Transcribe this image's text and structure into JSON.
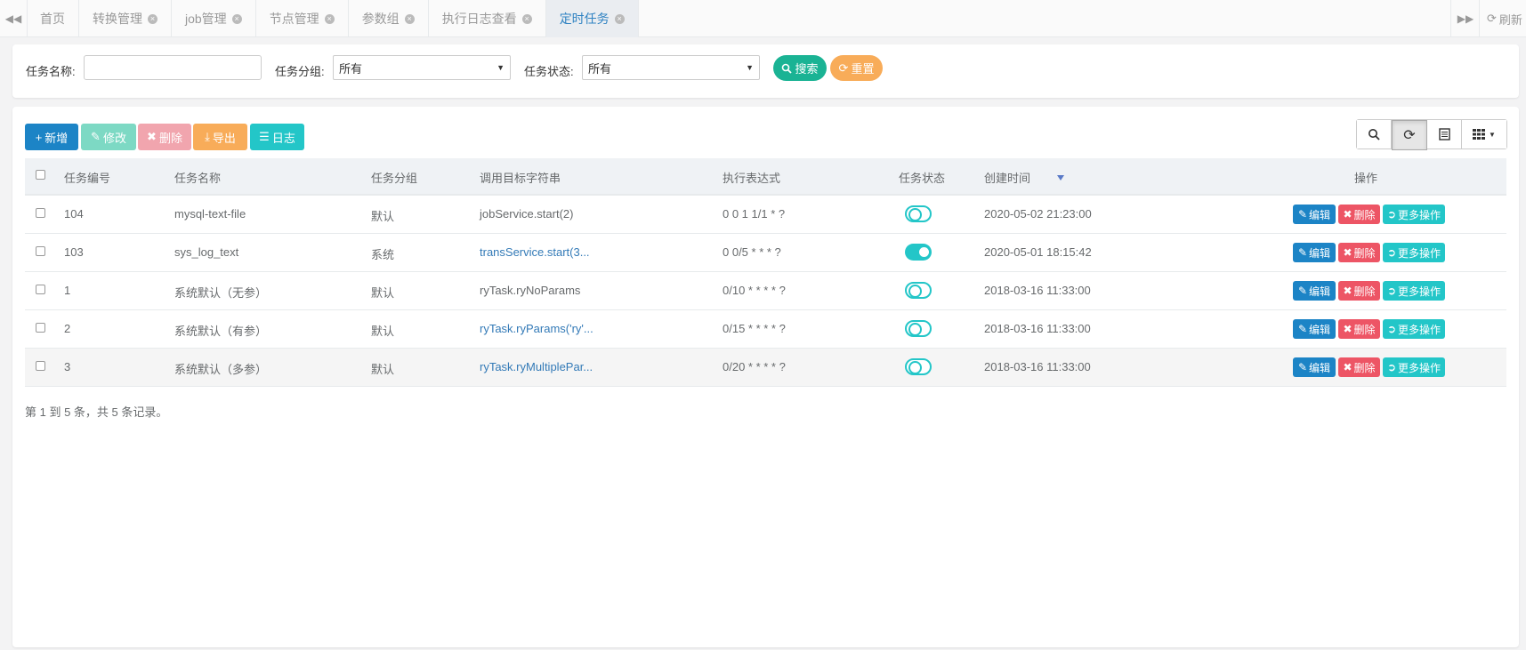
{
  "tabbar": {
    "tabs": [
      {
        "label": "首页",
        "closable": false,
        "active": false
      },
      {
        "label": "转换管理",
        "closable": true,
        "active": false
      },
      {
        "label": "job管理",
        "closable": true,
        "active": false
      },
      {
        "label": "节点管理",
        "closable": true,
        "active": false
      },
      {
        "label": "参数组",
        "closable": true,
        "active": false
      },
      {
        "label": "执行日志查看",
        "closable": true,
        "active": false
      },
      {
        "label": "定时任务",
        "closable": true,
        "active": true
      }
    ],
    "refresh_label": "刷新"
  },
  "search": {
    "task_name_label": "任务名称:",
    "task_name_value": "",
    "task_group_label": "任务分组:",
    "task_group_value": "所有",
    "task_status_label": "任务状态:",
    "task_status_value": "所有",
    "search_button": "搜索",
    "reset_button": "重置"
  },
  "toolbar": {
    "add": "新增",
    "edit": "修改",
    "delete": "删除",
    "export": "导出",
    "log": "日志"
  },
  "table": {
    "headers": [
      "任务编号",
      "任务名称",
      "任务分组",
      "调用目标字符串",
      "执行表达式",
      "任务状态",
      "创建时间",
      "操作"
    ],
    "rows": [
      {
        "id": "104",
        "name": "mysql-text-file",
        "group": "默认",
        "target": "jobService.start(2)",
        "target_link": false,
        "cron": "0 0 1 1/1 * ?",
        "status_on": false,
        "created": "2020-05-02 21:23:00"
      },
      {
        "id": "103",
        "name": "sys_log_text",
        "group": "系统",
        "target": "transService.start(3...",
        "target_link": true,
        "cron": "0 0/5 * * * ?",
        "status_on": true,
        "created": "2020-05-01 18:15:42"
      },
      {
        "id": "1",
        "name": "系统默认（无参）",
        "group": "默认",
        "target": "ryTask.ryNoParams",
        "target_link": false,
        "cron": "0/10 * * * * ?",
        "status_on": false,
        "created": "2018-03-16 11:33:00"
      },
      {
        "id": "2",
        "name": "系统默认（有参）",
        "group": "默认",
        "target": "ryTask.ryParams('ry'...",
        "target_link": true,
        "cron": "0/15 * * * * ?",
        "status_on": false,
        "created": "2018-03-16 11:33:00"
      },
      {
        "id": "3",
        "name": "系统默认（多参）",
        "group": "默认",
        "target": "ryTask.ryMultiplePar...",
        "target_link": true,
        "cron": "0/20 * * * * ?",
        "status_on": false,
        "created": "2018-03-16 11:33:00"
      }
    ],
    "row_actions": {
      "edit": "编辑",
      "delete": "删除",
      "more": "更多操作"
    }
  },
  "pager": {
    "summary": "第 1 到 5 条，共 5 条记录。"
  },
  "colors": {
    "primary": "#1c84c6",
    "success": "#1ab394",
    "warning": "#f8ac59",
    "danger": "#ed5565",
    "info": "#23c6c8"
  }
}
